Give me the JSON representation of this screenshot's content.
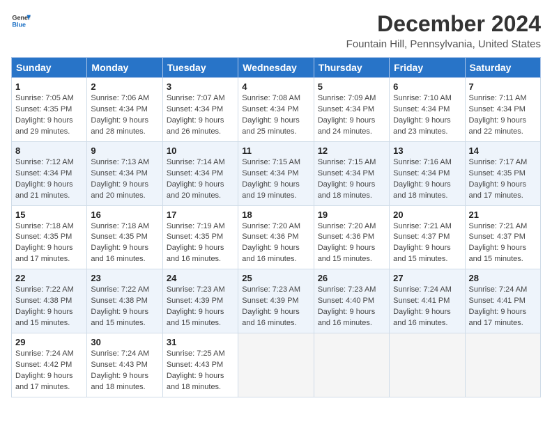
{
  "header": {
    "logo_general": "General",
    "logo_blue": "Blue",
    "month_title": "December 2024",
    "location": "Fountain Hill, Pennsylvania, United States"
  },
  "weekdays": [
    "Sunday",
    "Monday",
    "Tuesday",
    "Wednesday",
    "Thursday",
    "Friday",
    "Saturday"
  ],
  "weeks": [
    [
      {
        "day": "1",
        "sunrise": "Sunrise: 7:05 AM",
        "sunset": "Sunset: 4:35 PM",
        "daylight": "Daylight: 9 hours and 29 minutes."
      },
      {
        "day": "2",
        "sunrise": "Sunrise: 7:06 AM",
        "sunset": "Sunset: 4:34 PM",
        "daylight": "Daylight: 9 hours and 28 minutes."
      },
      {
        "day": "3",
        "sunrise": "Sunrise: 7:07 AM",
        "sunset": "Sunset: 4:34 PM",
        "daylight": "Daylight: 9 hours and 26 minutes."
      },
      {
        "day": "4",
        "sunrise": "Sunrise: 7:08 AM",
        "sunset": "Sunset: 4:34 PM",
        "daylight": "Daylight: 9 hours and 25 minutes."
      },
      {
        "day": "5",
        "sunrise": "Sunrise: 7:09 AM",
        "sunset": "Sunset: 4:34 PM",
        "daylight": "Daylight: 9 hours and 24 minutes."
      },
      {
        "day": "6",
        "sunrise": "Sunrise: 7:10 AM",
        "sunset": "Sunset: 4:34 PM",
        "daylight": "Daylight: 9 hours and 23 minutes."
      },
      {
        "day": "7",
        "sunrise": "Sunrise: 7:11 AM",
        "sunset": "Sunset: 4:34 PM",
        "daylight": "Daylight: 9 hours and 22 minutes."
      }
    ],
    [
      {
        "day": "8",
        "sunrise": "Sunrise: 7:12 AM",
        "sunset": "Sunset: 4:34 PM",
        "daylight": "Daylight: 9 hours and 21 minutes."
      },
      {
        "day": "9",
        "sunrise": "Sunrise: 7:13 AM",
        "sunset": "Sunset: 4:34 PM",
        "daylight": "Daylight: 9 hours and 20 minutes."
      },
      {
        "day": "10",
        "sunrise": "Sunrise: 7:14 AM",
        "sunset": "Sunset: 4:34 PM",
        "daylight": "Daylight: 9 hours and 20 minutes."
      },
      {
        "day": "11",
        "sunrise": "Sunrise: 7:15 AM",
        "sunset": "Sunset: 4:34 PM",
        "daylight": "Daylight: 9 hours and 19 minutes."
      },
      {
        "day": "12",
        "sunrise": "Sunrise: 7:15 AM",
        "sunset": "Sunset: 4:34 PM",
        "daylight": "Daylight: 9 hours and 18 minutes."
      },
      {
        "day": "13",
        "sunrise": "Sunrise: 7:16 AM",
        "sunset": "Sunset: 4:34 PM",
        "daylight": "Daylight: 9 hours and 18 minutes."
      },
      {
        "day": "14",
        "sunrise": "Sunrise: 7:17 AM",
        "sunset": "Sunset: 4:35 PM",
        "daylight": "Daylight: 9 hours and 17 minutes."
      }
    ],
    [
      {
        "day": "15",
        "sunrise": "Sunrise: 7:18 AM",
        "sunset": "Sunset: 4:35 PM",
        "daylight": "Daylight: 9 hours and 17 minutes."
      },
      {
        "day": "16",
        "sunrise": "Sunrise: 7:18 AM",
        "sunset": "Sunset: 4:35 PM",
        "daylight": "Daylight: 9 hours and 16 minutes."
      },
      {
        "day": "17",
        "sunrise": "Sunrise: 7:19 AM",
        "sunset": "Sunset: 4:35 PM",
        "daylight": "Daylight: 9 hours and 16 minutes."
      },
      {
        "day": "18",
        "sunrise": "Sunrise: 7:20 AM",
        "sunset": "Sunset: 4:36 PM",
        "daylight": "Daylight: 9 hours and 16 minutes."
      },
      {
        "day": "19",
        "sunrise": "Sunrise: 7:20 AM",
        "sunset": "Sunset: 4:36 PM",
        "daylight": "Daylight: 9 hours and 15 minutes."
      },
      {
        "day": "20",
        "sunrise": "Sunrise: 7:21 AM",
        "sunset": "Sunset: 4:37 PM",
        "daylight": "Daylight: 9 hours and 15 minutes."
      },
      {
        "day": "21",
        "sunrise": "Sunrise: 7:21 AM",
        "sunset": "Sunset: 4:37 PM",
        "daylight": "Daylight: 9 hours and 15 minutes."
      }
    ],
    [
      {
        "day": "22",
        "sunrise": "Sunrise: 7:22 AM",
        "sunset": "Sunset: 4:38 PM",
        "daylight": "Daylight: 9 hours and 15 minutes."
      },
      {
        "day": "23",
        "sunrise": "Sunrise: 7:22 AM",
        "sunset": "Sunset: 4:38 PM",
        "daylight": "Daylight: 9 hours and 15 minutes."
      },
      {
        "day": "24",
        "sunrise": "Sunrise: 7:23 AM",
        "sunset": "Sunset: 4:39 PM",
        "daylight": "Daylight: 9 hours and 15 minutes."
      },
      {
        "day": "25",
        "sunrise": "Sunrise: 7:23 AM",
        "sunset": "Sunset: 4:39 PM",
        "daylight": "Daylight: 9 hours and 16 minutes."
      },
      {
        "day": "26",
        "sunrise": "Sunrise: 7:23 AM",
        "sunset": "Sunset: 4:40 PM",
        "daylight": "Daylight: 9 hours and 16 minutes."
      },
      {
        "day": "27",
        "sunrise": "Sunrise: 7:24 AM",
        "sunset": "Sunset: 4:41 PM",
        "daylight": "Daylight: 9 hours and 16 minutes."
      },
      {
        "day": "28",
        "sunrise": "Sunrise: 7:24 AM",
        "sunset": "Sunset: 4:41 PM",
        "daylight": "Daylight: 9 hours and 17 minutes."
      }
    ],
    [
      {
        "day": "29",
        "sunrise": "Sunrise: 7:24 AM",
        "sunset": "Sunset: 4:42 PM",
        "daylight": "Daylight: 9 hours and 17 minutes."
      },
      {
        "day": "30",
        "sunrise": "Sunrise: 7:24 AM",
        "sunset": "Sunset: 4:43 PM",
        "daylight": "Daylight: 9 hours and 18 minutes."
      },
      {
        "day": "31",
        "sunrise": "Sunrise: 7:25 AM",
        "sunset": "Sunset: 4:43 PM",
        "daylight": "Daylight: 9 hours and 18 minutes."
      },
      null,
      null,
      null,
      null
    ]
  ]
}
